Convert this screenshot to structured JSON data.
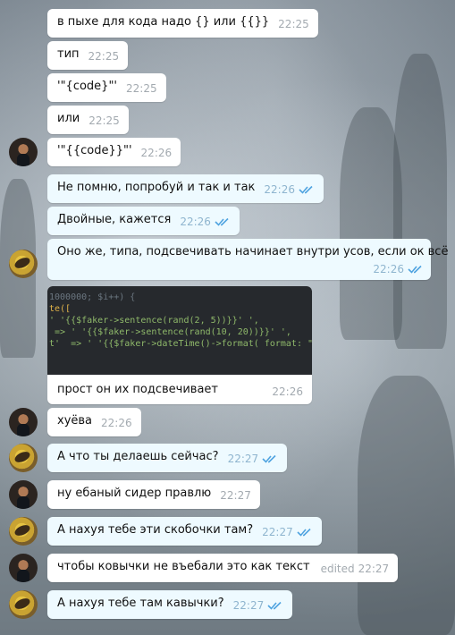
{
  "messages": [
    {
      "text": "в пыхе для кода надо {} или {{}}",
      "time": "22:25",
      "outgoing": false,
      "avatar": "none"
    },
    {
      "text": "тип",
      "time": "22:25",
      "outgoing": false,
      "avatar": "none"
    },
    {
      "text": "'\"{code}\"'",
      "time": "22:25",
      "outgoing": false,
      "avatar": "none"
    },
    {
      "text": "или",
      "time": "22:25",
      "outgoing": false,
      "avatar": "none"
    },
    {
      "text": "'\"{{code}}\"'",
      "time": "22:26",
      "outgoing": false,
      "avatar": "dark"
    },
    {
      "text": "Не помню, попробуй и так и так",
      "time": "22:26",
      "outgoing": true,
      "avatar": "none"
    },
    {
      "text": "Двойные, кажется",
      "time": "22:26",
      "outgoing": true,
      "avatar": "none"
    },
    {
      "text": "Оно же, типа, подсвечивать начинает внутри усов, если ок всё",
      "time": "22:26",
      "outgoing": true,
      "avatar": "yellow"
    },
    {
      "text": "хуёва",
      "time": "22:26",
      "outgoing": false,
      "avatar": "dark"
    },
    {
      "text": "А что ты делаешь сейчас?",
      "time": "22:27",
      "outgoing": true,
      "avatar": "yellow"
    },
    {
      "text": "ну ебаный сидер правлю",
      "time": "22:27",
      "outgoing": false,
      "avatar": "dark"
    },
    {
      "text": "А нахуя тебе эти скобочки там?",
      "time": "22:27",
      "outgoing": true,
      "avatar": "yellow"
    },
    {
      "text": "чтобы ковычки не въебали это как текст",
      "time": "22:27",
      "outgoing": false,
      "avatar": "dark",
      "edited": "edited"
    },
    {
      "text": "А нахуя тебе там кавычки?",
      "time": "22:27",
      "outgoing": true,
      "avatar": "yellow"
    }
  ],
  "image_message": {
    "caption": "прост он их подсвечивает",
    "time": "22:26",
    "code_lines": [
      "1000000; $i++) {",
      "te([",
      "' '{{$faker->sentence(rand(2, 5))}}' ',",
      " => ' '{{$faker->sentence(rand(10, 20))}}' ',",
      "t'  => ' '{{$faker->dateTime()->format( format: \"Y-m-d"
    ]
  },
  "colors": {
    "incoming_bubble": "#ffffff",
    "outgoing_bubble": "#eefaff",
    "read_check": "#4fa3e0"
  }
}
